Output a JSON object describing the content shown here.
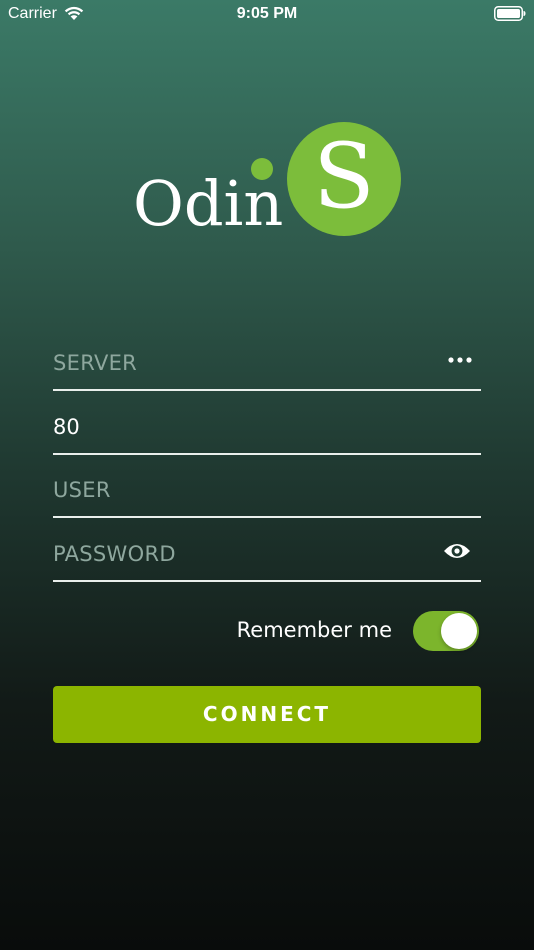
{
  "status_bar": {
    "carrier": "Carrier",
    "time": "9:05 PM",
    "wifi_icon": "wifi-icon",
    "battery_icon": "battery-icon"
  },
  "logo": {
    "word": "Odin",
    "letter": "S",
    "accent_color": "#7cbd3b"
  },
  "form": {
    "server": {
      "placeholder": "SERVER",
      "value": "",
      "action_icon": "more-dots-icon"
    },
    "port": {
      "placeholder": "",
      "value": "80"
    },
    "user": {
      "placeholder": "USER",
      "value": ""
    },
    "password": {
      "placeholder": "PASSWORD",
      "value": "",
      "action_icon": "eye-icon"
    }
  },
  "remember": {
    "label": "Remember me",
    "enabled": true,
    "toggle_color": "#7cb52c"
  },
  "connect": {
    "label": "CONNECT",
    "color": "#8cb500"
  }
}
